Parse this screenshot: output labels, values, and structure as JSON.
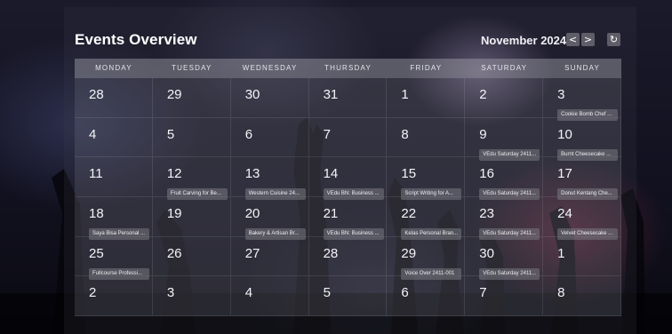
{
  "title": "Events Overview",
  "month_label": "November 2024",
  "nav": {
    "prev": "<",
    "next": ">",
    "refresh": "↻"
  },
  "weekdays": [
    "MONDAY",
    "TUESDAY",
    "WEDNESDAY",
    "THURSDAY",
    "FRIDAY",
    "SATURDAY",
    "SUNDAY"
  ],
  "weeks": [
    [
      {
        "day": "28"
      },
      {
        "day": "29"
      },
      {
        "day": "30"
      },
      {
        "day": "31"
      },
      {
        "day": "1"
      },
      {
        "day": "2"
      },
      {
        "day": "3",
        "event": "Cookie Bomb Chef ..."
      }
    ],
    [
      {
        "day": "4"
      },
      {
        "day": "5"
      },
      {
        "day": "6"
      },
      {
        "day": "7"
      },
      {
        "day": "8"
      },
      {
        "day": "9",
        "event": "VEdu Saturday 2411..."
      },
      {
        "day": "10",
        "event": "Burnt Cheesecake ..."
      }
    ],
    [
      {
        "day": "11"
      },
      {
        "day": "12",
        "event": "Fruit Carving for Be..."
      },
      {
        "day": "13",
        "event": "Western Cuisine 24..."
      },
      {
        "day": "14",
        "event": "VEdu BN: Business ..."
      },
      {
        "day": "15",
        "event": "Script Writing for A..."
      },
      {
        "day": "16",
        "event": "VEdu Saturday 2411..."
      },
      {
        "day": "17",
        "event": "Donut Kentang Che..."
      }
    ],
    [
      {
        "day": "18",
        "event": "Saya Bisa Personal ..."
      },
      {
        "day": "19"
      },
      {
        "day": "20",
        "event": "Bakery & Artisan Br..."
      },
      {
        "day": "21",
        "event": "VEdu BN: Business ..."
      },
      {
        "day": "22",
        "event": "Kelas Personal Bran..."
      },
      {
        "day": "23",
        "event": "VEdu Saturday 2411..."
      },
      {
        "day": "24",
        "event": "Velvet Cheesecake ..."
      }
    ],
    [
      {
        "day": "25",
        "event": "Fullcourse Professi..."
      },
      {
        "day": "26"
      },
      {
        "day": "27"
      },
      {
        "day": "28"
      },
      {
        "day": "29",
        "event": "Voice Over 2411-001"
      },
      {
        "day": "30",
        "event": "VEdu Saturday 2411..."
      },
      {
        "day": "1"
      }
    ],
    [
      {
        "day": "2"
      },
      {
        "day": "3"
      },
      {
        "day": "4"
      },
      {
        "day": "5"
      },
      {
        "day": "6"
      },
      {
        "day": "7"
      },
      {
        "day": "8"
      }
    ]
  ]
}
